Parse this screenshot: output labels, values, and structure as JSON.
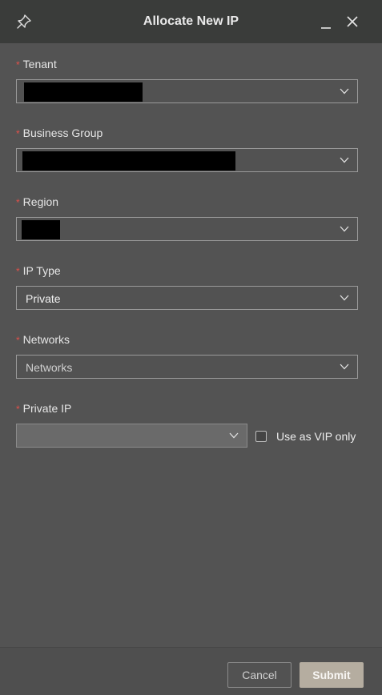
{
  "dialog": {
    "title": "Allocate New IP",
    "pin_icon": "pin-icon",
    "minimize_icon": "minimize-icon",
    "close_icon": "close-icon"
  },
  "fields": {
    "tenant": {
      "label": "Tenant",
      "required_mark": "*",
      "value": ""
    },
    "business_group": {
      "label": "Business Group",
      "required_mark": "*",
      "value": ""
    },
    "region": {
      "label": "Region",
      "required_mark": "*",
      "value": ""
    },
    "ip_type": {
      "label": "IP Type",
      "required_mark": "*",
      "value": "Private"
    },
    "networks": {
      "label": "Networks",
      "required_mark": "*",
      "placeholder": "Networks"
    },
    "private_ip": {
      "label": "Private IP",
      "required_mark": "*",
      "value": ""
    }
  },
  "vip_only": {
    "label": "Use as VIP only",
    "checked": false
  },
  "footer": {
    "cancel_label": "Cancel",
    "submit_label": "Submit"
  },
  "colors": {
    "background": "#535353",
    "titlebar": "#3a3c3a",
    "required": "#e2504a",
    "submit": "#b5ada0"
  }
}
